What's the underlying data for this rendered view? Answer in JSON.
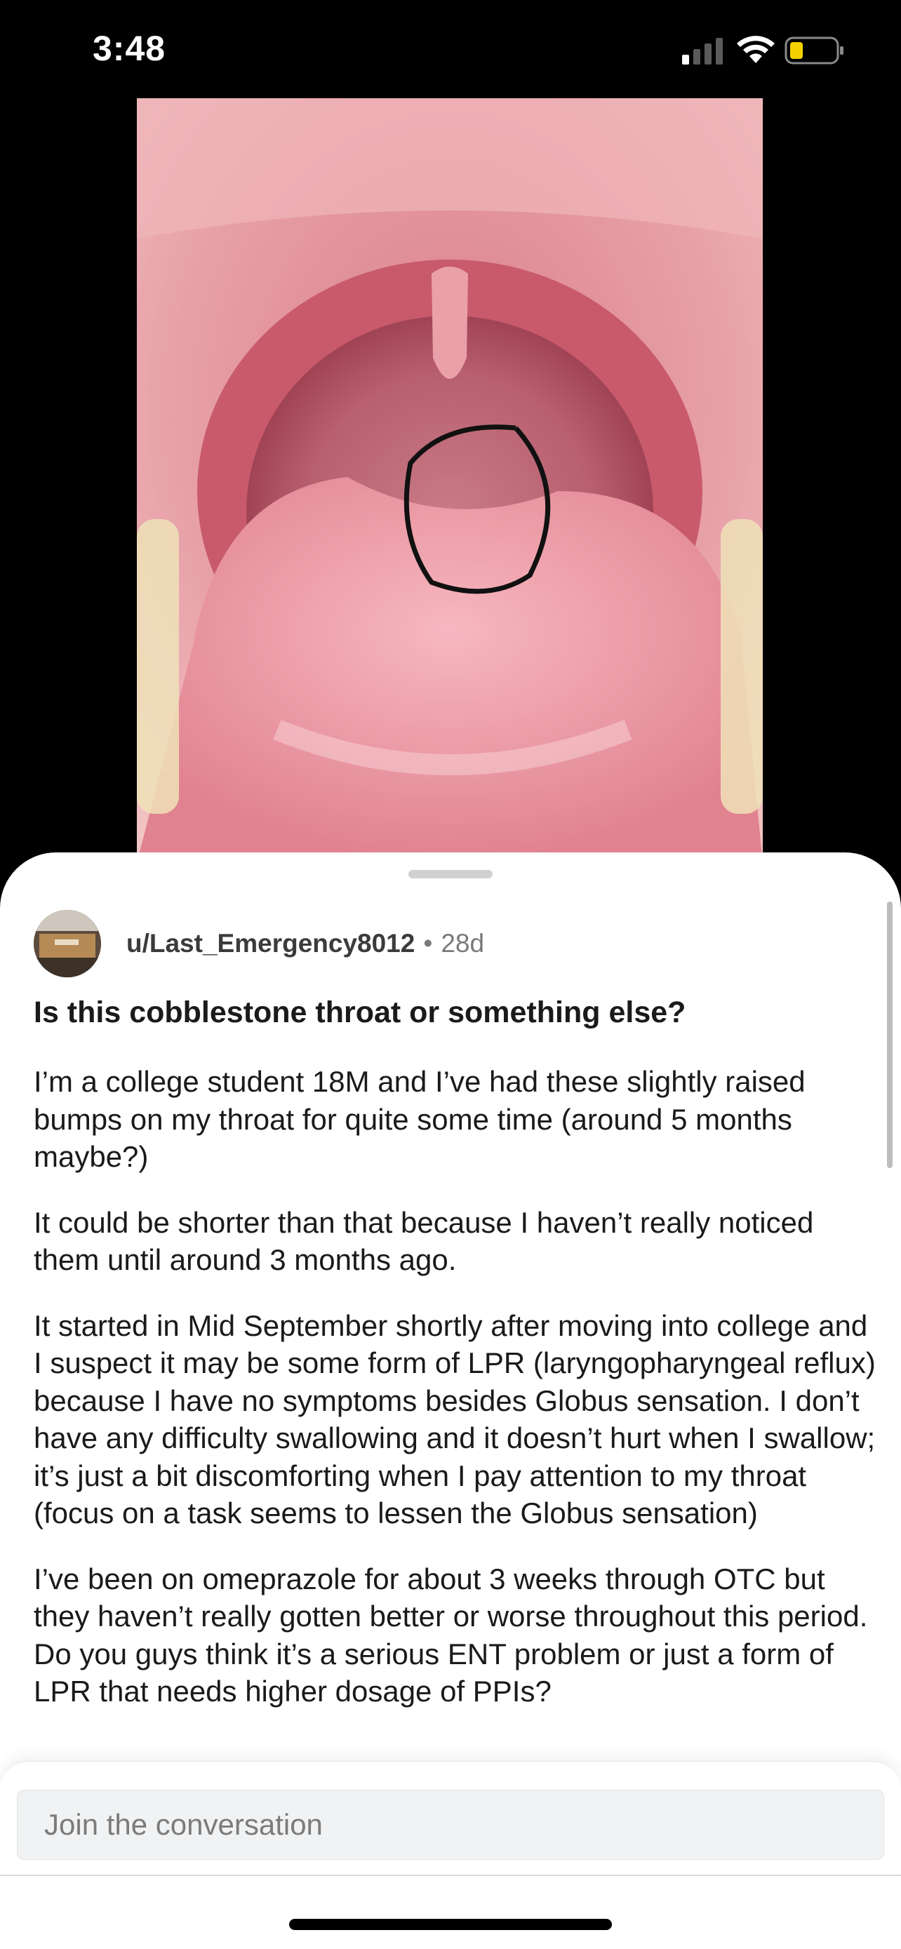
{
  "status_bar": {
    "time": "3:48"
  },
  "post": {
    "author": "u/Last_Emergency8012",
    "separator": "•",
    "age": "28d",
    "title": "Is this cobblestone throat or something else?",
    "paragraphs": [
      "I’m a college student 18M and I’ve had these slightly raised bumps on my throat for quite some time (around 5 months maybe?)",
      "It could be shorter than that because I haven’t really noticed them until around 3 months ago.",
      "It started in Mid September shortly after moving into college and I suspect it may be some form of LPR (laryngopharyngeal reflux) because I have no symptoms besides Globus sensation. I don’t have any difficulty swallowing and it doesn’t hurt when I swallow; it’s just a bit discomforting when I pay attention to my throat (focus on a task seems to lessen the Globus sensation)",
      "I’ve been on omeprazole for about 3 weeks through OTC but they haven’t really gotten better or worse throughout this period. Do you guys think it’s a serious ENT problem or just a form of LPR that needs higher dosage of PPIs?"
    ]
  },
  "comment": {
    "placeholder": "Join the conversation"
  }
}
